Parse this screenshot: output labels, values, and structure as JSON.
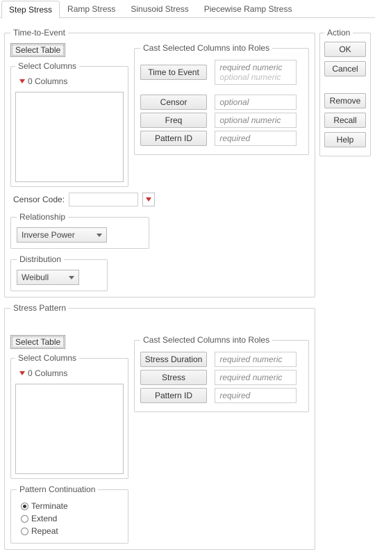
{
  "tabs": [
    {
      "label": "Step Stress",
      "active": true
    },
    {
      "label": "Ramp Stress",
      "active": false
    },
    {
      "label": "Sinusoid Stress",
      "active": false
    },
    {
      "label": "Piecewise Ramp Stress",
      "active": false
    }
  ],
  "action": {
    "legend": "Action",
    "ok": "OK",
    "cancel": "Cancel",
    "remove": "Remove",
    "recall": "Recall",
    "help": "Help"
  },
  "tte": {
    "legend": "Time-to-Event",
    "selectTable": "Select Table",
    "selectColumns": {
      "legend": "Select Columns",
      "count": "0 Columns"
    },
    "roles": {
      "legend": "Cast Selected Columns into Roles",
      "rows": [
        {
          "btn": "Time to Event",
          "hints": [
            "required numeric",
            "optional numeric"
          ]
        },
        {
          "btn": "Censor",
          "hints": [
            "optional"
          ]
        },
        {
          "btn": "Freq",
          "hints": [
            "optional numeric"
          ]
        },
        {
          "btn": "Pattern ID",
          "hints": [
            "required"
          ]
        }
      ]
    },
    "censorCodeLabel": "Censor Code:",
    "relationship": {
      "legend": "Relationship",
      "value": "Inverse Power"
    },
    "distribution": {
      "legend": "Distribution",
      "value": "Weibull"
    }
  },
  "sp": {
    "legend": "Stress Pattern",
    "selectTable": "Select Table",
    "selectColumns": {
      "legend": "Select Columns",
      "count": "0 Columns"
    },
    "roles": {
      "legend": "Cast Selected Columns into Roles",
      "rows": [
        {
          "btn": "Stress Duration",
          "hints": [
            "required numeric"
          ]
        },
        {
          "btn": "Stress",
          "hints": [
            "required numeric"
          ]
        },
        {
          "btn": "Pattern ID",
          "hints": [
            "required"
          ]
        }
      ]
    },
    "patternCont": {
      "legend": "Pattern Continuation",
      "options": [
        {
          "label": "Terminate",
          "checked": true
        },
        {
          "label": "Extend",
          "checked": false
        },
        {
          "label": "Repeat",
          "checked": false
        }
      ]
    }
  }
}
